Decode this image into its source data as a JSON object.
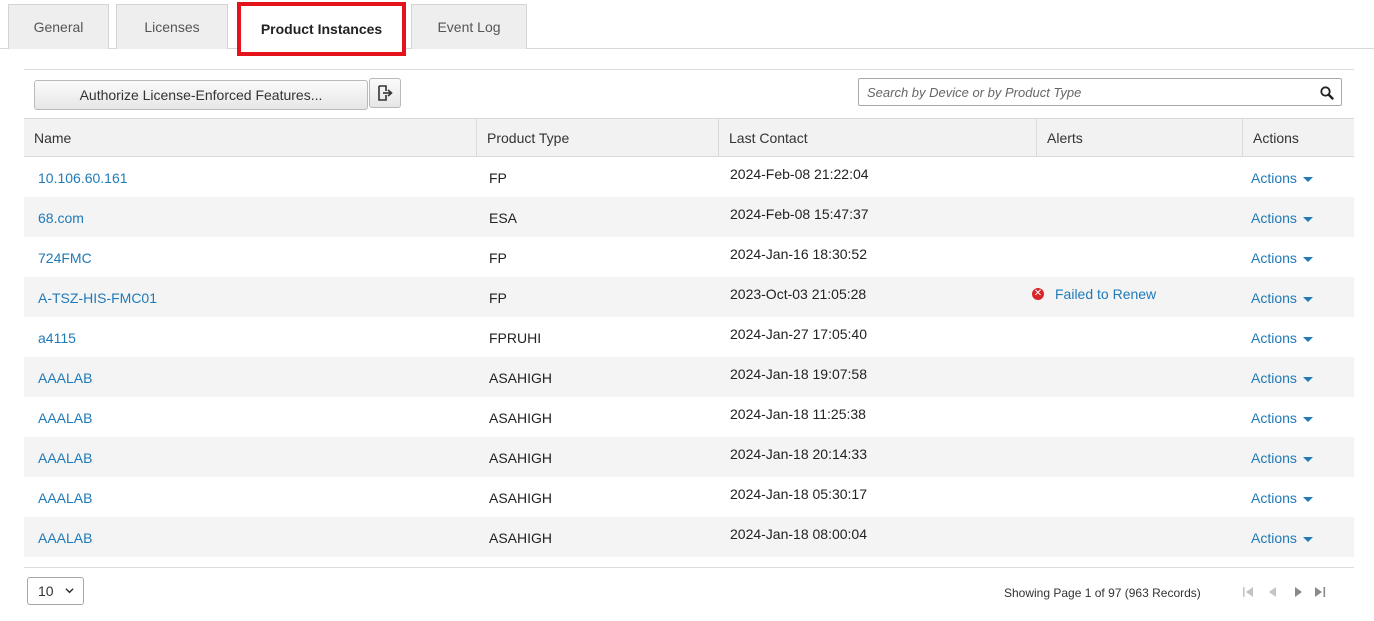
{
  "tabs": [
    {
      "label": "General"
    },
    {
      "label": "Licenses"
    },
    {
      "label": "Product Instances"
    },
    {
      "label": "Event Log"
    }
  ],
  "toolbar": {
    "authorize_label": "Authorize License-Enforced Features...",
    "export_icon": "export-icon"
  },
  "search": {
    "placeholder": "Search by Device or by Product Type",
    "value": ""
  },
  "table": {
    "columns": [
      "Name",
      "Product Type",
      "Last Contact",
      "Alerts",
      "Actions"
    ],
    "rows": [
      {
        "name": "10.106.60.161",
        "type": "FP",
        "last_contact": "2024-Feb-08 21:22:04",
        "alert": "",
        "actions": "Actions"
      },
      {
        "name": "68.com",
        "type": "ESA",
        "last_contact": "2024-Feb-08 15:47:37",
        "alert": "",
        "actions": "Actions"
      },
      {
        "name": "724FMC",
        "type": "FP",
        "last_contact": "2024-Jan-16 18:30:52",
        "alert": "",
        "actions": "Actions"
      },
      {
        "name": "A-TSZ-HIS-FMC01",
        "type": "FP",
        "last_contact": "2023-Oct-03 21:05:28",
        "alert": "Failed to Renew",
        "actions": "Actions"
      },
      {
        "name": "a4115",
        "type": "FPRUHI",
        "last_contact": "2024-Jan-27 17:05:40",
        "alert": "",
        "actions": "Actions"
      },
      {
        "name": "AAALAB",
        "type": "ASAHIGH",
        "last_contact": "2024-Jan-18 19:07:58",
        "alert": "",
        "actions": "Actions"
      },
      {
        "name": "AAALAB",
        "type": "ASAHIGH",
        "last_contact": "2024-Jan-18 11:25:38",
        "alert": "",
        "actions": "Actions"
      },
      {
        "name": "AAALAB",
        "type": "ASAHIGH",
        "last_contact": "2024-Jan-18 20:14:33",
        "alert": "",
        "actions": "Actions"
      },
      {
        "name": "AAALAB",
        "type": "ASAHIGH",
        "last_contact": "2024-Jan-18 05:30:17",
        "alert": "",
        "actions": "Actions"
      },
      {
        "name": "AAALAB",
        "type": "ASAHIGH",
        "last_contact": "2024-Jan-18 08:00:04",
        "alert": "",
        "actions": "Actions"
      }
    ]
  },
  "footer": {
    "page_size": "10",
    "records_text": "Showing Page 1 of 97 (963 Records)"
  },
  "colors": {
    "link": "#1f7ab8",
    "active_tab_highlight": "#e3121b",
    "alert_error": "#d9262b"
  }
}
